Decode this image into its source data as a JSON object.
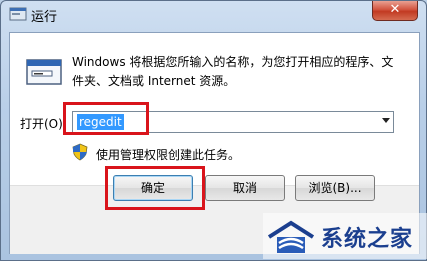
{
  "window": {
    "title": "运行",
    "close_label": "✕"
  },
  "dialog": {
    "description": "Windows 将根据您所输入的名称，为您打开相应的程序、文件夹、文档或 Internet 资源。",
    "open_label": "打开(O):",
    "input_value": "regedit",
    "admin_note": "使用管理权限创建此任务。"
  },
  "buttons": {
    "ok": "确定",
    "cancel": "取消",
    "browse": "浏览(B)..."
  },
  "watermark": {
    "text": "系统之家",
    "logo": "system-home-logo"
  },
  "colors": {
    "highlight": "#d9141b",
    "selection": "#3399ff"
  }
}
